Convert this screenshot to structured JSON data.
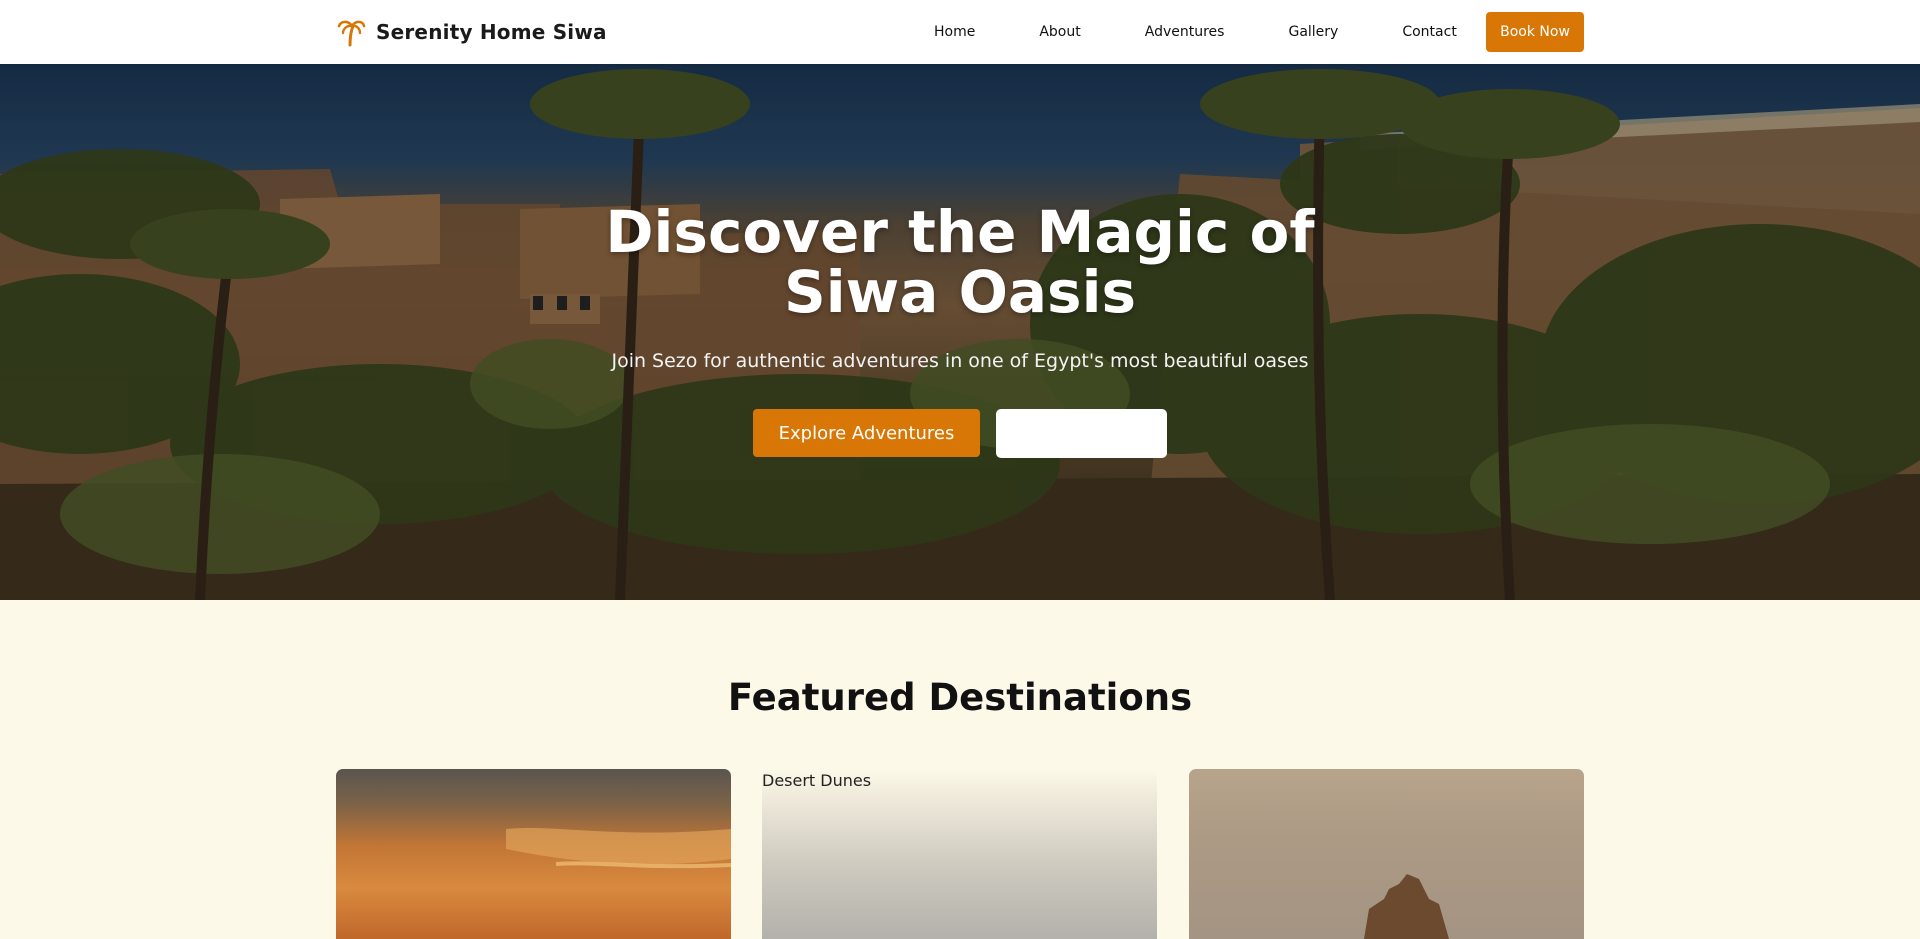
{
  "brand": {
    "name": "Serenity Home Siwa",
    "icon": "palm-tree-icon",
    "accent": "#d97706"
  },
  "nav": {
    "links": [
      "Home",
      "About",
      "Adventures",
      "Gallery",
      "Contact"
    ],
    "cta": "Book Now"
  },
  "hero": {
    "title": "Discover the Magic of Siwa Oasis",
    "subtitle": "Join Sezo for authentic adventures in one of Egypt's most beautiful oases",
    "primary_button": "Explore Adventures",
    "secondary_button": ""
  },
  "featured": {
    "title": "Featured Destinations",
    "cards": [
      {
        "label": ""
      },
      {
        "label": "Desert Dunes"
      },
      {
        "label": ""
      }
    ]
  },
  "colors": {
    "accent": "#d97706",
    "section_bg": "#fdf9e8",
    "nav_bg": "#ffffff"
  }
}
